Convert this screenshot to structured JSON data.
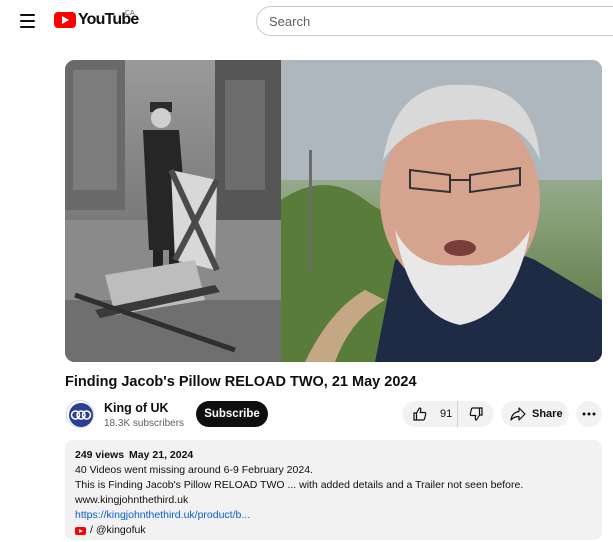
{
  "header": {
    "logo_text": "YouTube",
    "country_code": "CA",
    "search_placeholder": "Search"
  },
  "video": {
    "title": "Finding Jacob's Pillow RELOAD TWO, 21 May 2024"
  },
  "channel": {
    "name": "King of UK",
    "subscribers": "18.3K subscribers",
    "subscribe_label": "Subscribe"
  },
  "actions": {
    "like_count": "91",
    "share_label": "Share"
  },
  "description": {
    "views": "249 views",
    "date": "May 21, 2024",
    "lines": [
      "40 Videos went missing around 6-9 February 2024.",
      "This is Finding Jacob's Pillow RELOAD TWO ... with added details and a Trailer not seen before.",
      "www.kingjohnthethird.uk"
    ],
    "link": "https://kingjohnthethird.uk/product/b...",
    "handle": "/ @kingofuk"
  },
  "colors": {
    "brand_red": "#ff0000",
    "link_blue": "#065fd4",
    "subscribe_bg": "#0f0f0f",
    "pill_bg": "#f2f2f2"
  },
  "icons": [
    "menu-icon",
    "youtube-logo-icon",
    "like-icon",
    "dislike-icon",
    "share-icon",
    "more-icon",
    "youtube-mini-icon"
  ]
}
